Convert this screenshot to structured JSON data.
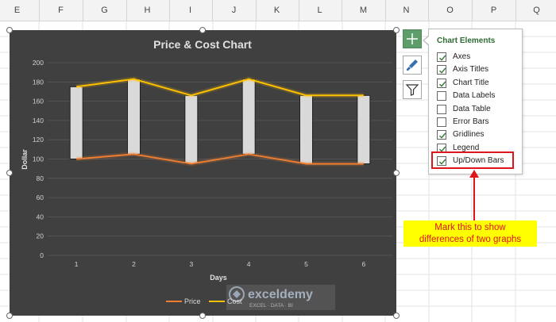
{
  "columns": [
    "E",
    "F",
    "G",
    "H",
    "I",
    "J",
    "K",
    "L",
    "M",
    "N",
    "O",
    "P",
    "Q"
  ],
  "chart_data": {
    "type": "line",
    "title": "Price & Cost Chart",
    "xlabel": "Days",
    "ylabel": "Dollar",
    "categories": [
      "1",
      "2",
      "3",
      "4",
      "5",
      "6"
    ],
    "ylim": [
      0,
      200
    ],
    "yticks": [
      0,
      20,
      40,
      60,
      80,
      100,
      120,
      140,
      160,
      180,
      200
    ],
    "grid": true,
    "legend_position": "bottom",
    "updown_bars": true,
    "series": [
      {
        "name": "Price",
        "values": [
          100,
          105,
          95,
          105,
          95,
          95
        ],
        "color": "#ed7d31"
      },
      {
        "name": "Cost",
        "values": [
          175,
          183,
          166,
          183,
          166,
          166
        ],
        "color": "#ffc000"
      }
    ],
    "background": "#404040"
  },
  "chart_elements_panel": {
    "title": "Chart Elements",
    "items": [
      {
        "label": "Axes",
        "checked": true
      },
      {
        "label": "Axis Titles",
        "checked": true
      },
      {
        "label": "Chart Title",
        "checked": true
      },
      {
        "label": "Data Labels",
        "checked": false
      },
      {
        "label": "Data Table",
        "checked": false
      },
      {
        "label": "Error Bars",
        "checked": false
      },
      {
        "label": "Gridlines",
        "checked": true
      },
      {
        "label": "Legend",
        "checked": true
      },
      {
        "label": "Up/Down Bars",
        "checked": true
      }
    ]
  },
  "side_buttons": {
    "plus_icon": "plus-icon",
    "brush_icon": "brush-icon",
    "filter_icon": "filter-icon"
  },
  "callout": {
    "line1": "Mark this to show",
    "line2": "differences of two graphs",
    "color": "#e0141c",
    "background": "#ffff00"
  },
  "watermark": {
    "brand": "exceldemy",
    "tagline": "EXCEL · DATA · BI"
  }
}
